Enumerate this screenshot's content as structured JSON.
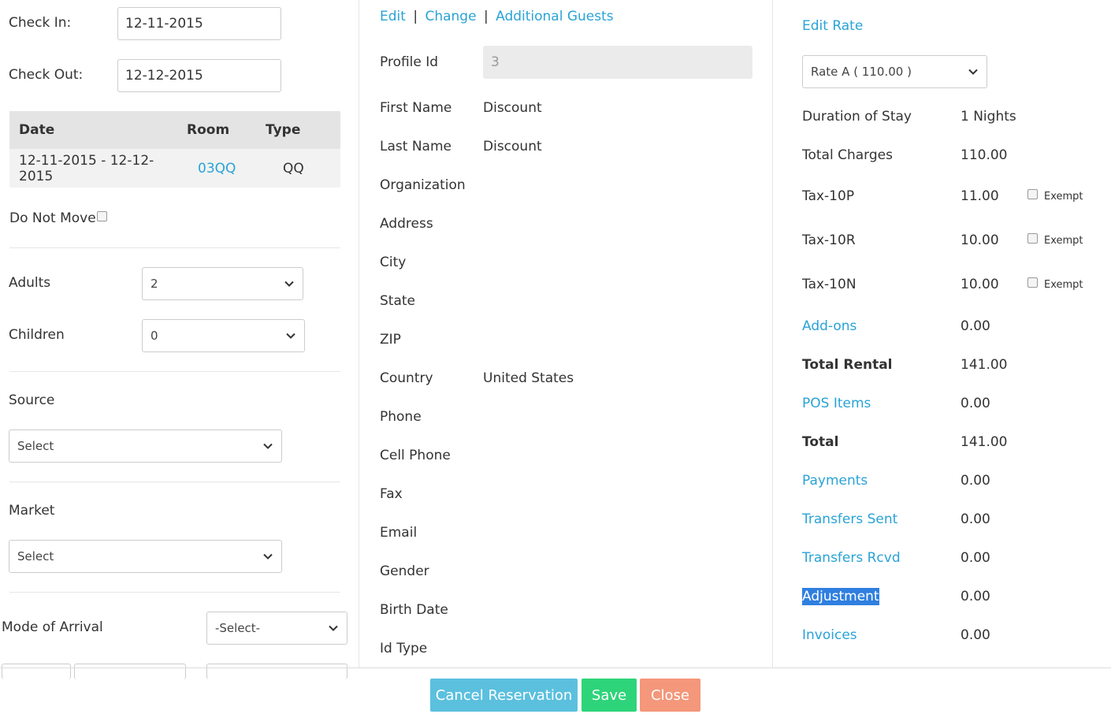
{
  "left": {
    "check_in_label": "Check In:",
    "check_in_value": "12-11-2015",
    "check_out_label": "Check Out:",
    "check_out_value": "12-12-2015",
    "room_table": {
      "headers": [
        "Date",
        "Room",
        "Type"
      ],
      "row": {
        "date": "12-11-2015 - 12-12-2015",
        "room": "03QQ",
        "type": "QQ"
      }
    },
    "do_not_move_label": "Do Not Move",
    "adults_label": "Adults",
    "adults_value": "2",
    "children_label": "Children",
    "children_value": "0",
    "source_label": "Source",
    "source_value": "Select",
    "market_label": "Market",
    "market_value": "Select",
    "mode_of_arrival_label": "Mode of Arrival",
    "mode_of_arrival_value": "-Select-"
  },
  "middle": {
    "links": {
      "edit": "Edit",
      "change": "Change",
      "additional_guests": "Additional Guests",
      "sep": "|"
    },
    "profile_id_label": "Profile Id",
    "profile_id_value": "3",
    "fields": [
      {
        "label": "First Name",
        "value": "Discount"
      },
      {
        "label": "Last Name",
        "value": "Discount"
      },
      {
        "label": "Organization",
        "value": ""
      },
      {
        "label": "Address",
        "value": ""
      },
      {
        "label": "City",
        "value": ""
      },
      {
        "label": "State",
        "value": ""
      },
      {
        "label": "ZIP",
        "value": ""
      },
      {
        "label": "Country",
        "value": "United States"
      },
      {
        "label": "Phone",
        "value": ""
      },
      {
        "label": "Cell Phone",
        "value": ""
      },
      {
        "label": "Fax",
        "value": ""
      },
      {
        "label": "Email",
        "value": ""
      },
      {
        "label": "Gender",
        "value": ""
      },
      {
        "label": "Birth Date",
        "value": ""
      },
      {
        "label": "Id Type",
        "value": ""
      }
    ]
  },
  "right": {
    "edit_rate_label": "Edit Rate",
    "rate_value": "Rate A ( 110.00 )",
    "duration_label": "Duration of Stay",
    "duration_value": "1 Nights",
    "total_charges_label": "Total Charges",
    "total_charges_value": "110.00",
    "taxes": [
      {
        "label": "Tax-10P",
        "value": "11.00",
        "exempt": "Exempt"
      },
      {
        "label": "Tax-10R",
        "value": "10.00",
        "exempt": "Exempt"
      },
      {
        "label": "Tax-10N",
        "value": "10.00",
        "exempt": "Exempt"
      }
    ],
    "addons_label": "Add-ons",
    "addons_value": "0.00",
    "total_rental_label": "Total Rental",
    "total_rental_value": "141.00",
    "pos_items_label": "POS Items",
    "pos_items_value": "0.00",
    "total_label": "Total",
    "total_value": "141.00",
    "payments_label": "Payments",
    "payments_value": "0.00",
    "transfers_sent_label": "Transfers Sent",
    "transfers_sent_value": "0.00",
    "transfers_rcvd_label": "Transfers Rcvd",
    "transfers_rcvd_value": "0.00",
    "adjustment_label": "Adjustment",
    "adjustment_value": "0.00",
    "invoices_label": "Invoices",
    "invoices_value": "0.00"
  },
  "footer": {
    "cancel_reservation": "Cancel Reservation",
    "save": "Save",
    "close": "Close"
  },
  "colors": {
    "link": "#29a3d6",
    "cancel_button": "#5bc0de",
    "save_button": "#2ed47a",
    "close_button": "#f4977a",
    "selection_highlight": "#2f7fe0"
  }
}
